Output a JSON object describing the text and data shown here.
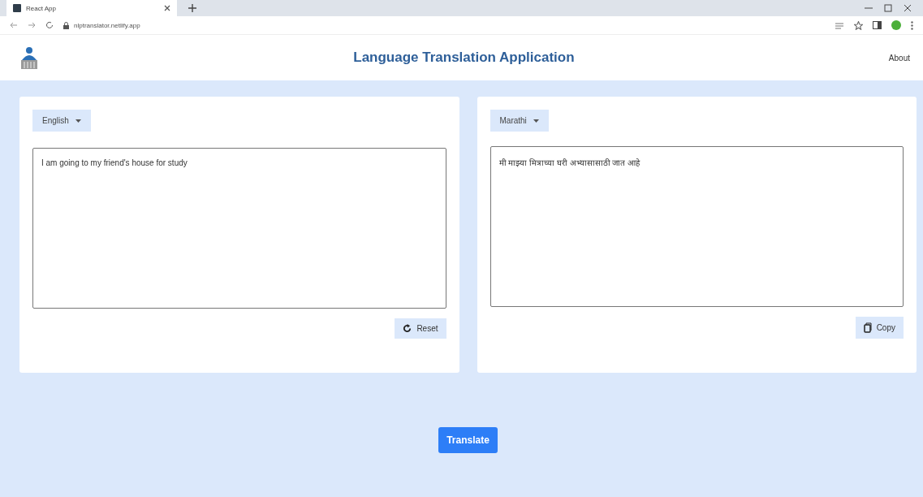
{
  "browser": {
    "tab_title": "React App",
    "url": "nlptranslator.netlify.app"
  },
  "header": {
    "title": "Language Translation Application",
    "nav": "About"
  },
  "source": {
    "language": "English",
    "text": "I am going to my friend's house for study",
    "button": "Reset"
  },
  "target": {
    "language": "Marathi",
    "text": "मी माझ्या मित्राच्या घरी अभ्यासासाठी जात आहे",
    "button": "Copy"
  },
  "action": "Translate"
}
